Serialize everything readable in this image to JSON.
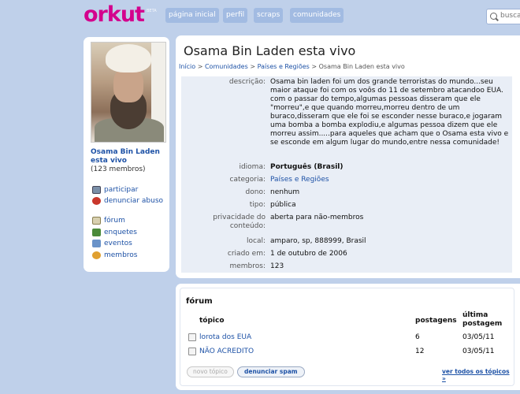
{
  "header": {
    "logo": "orkut",
    "logo_beta": "BETA",
    "nav": [
      "página inicial",
      "perfil",
      "scraps",
      "comunidades"
    ],
    "search_placeholder": "busca"
  },
  "sidebar": {
    "community_name": "Osama Bin Laden esta vivo",
    "members_count": "(123 membros)",
    "actions": [
      "participar",
      "denunciar abuso"
    ],
    "links": [
      "fórum",
      "enquetes",
      "eventos",
      "membros"
    ]
  },
  "main": {
    "title": "Osama Bin Laden esta vivo",
    "breadcrumb": [
      "Início",
      "Comunidades",
      "Países e Regiões",
      "Osama Bin Laden esta vivo"
    ],
    "breadcrumb_sep": ">",
    "fields": [
      {
        "label": "descrição:",
        "value": "Osama bin laden foi um dos grande terroristas do mundo...seu maior ataque foi com os voôs do 11 de setembro atacandoo EUA. com o passar do tempo,algumas pessoas disseram que ele \"morreu\",e que quando morreu,morreu dentro de um buraco,disseram que ele foi se esconder nesse buraco,e jogaram uma bomba a bomba explodiu,e algumas pessoa dizem que ele morreu assim.....para aqueles que acham que o Osama esta vivo e se esconde em algum lugar do mundo,entre nessa comunidade!"
      },
      {
        "label": "idioma:",
        "value": "Português (Brasil)"
      },
      {
        "label": "categoria:",
        "value": "Países e Regiões"
      },
      {
        "label": "dono:",
        "value": "nenhum"
      },
      {
        "label": "tipo:",
        "value": "pública"
      },
      {
        "label": "privacidade do conteúdo:",
        "value": "aberta para não-membros"
      },
      {
        "label": "local:",
        "value": "amparo, sp, 888999, Brasil"
      },
      {
        "label": "criado em:",
        "value": "1 de outubro de 2006"
      },
      {
        "label": "membros:",
        "value": "123"
      }
    ]
  },
  "forum": {
    "title": "fórum",
    "columns": {
      "topic": "tópico",
      "posts": "postagens",
      "last_post": "última postagem"
    },
    "topics": [
      {
        "title": "lorota dos EUA",
        "posts": "6",
        "last": "03/05/11"
      },
      {
        "title": "NÃO ACREDITO",
        "posts": "12",
        "last": "03/05/11"
      }
    ],
    "new_topic_label": "novo tópico",
    "report_spam_label": "denunciar spam",
    "see_all_label": "ver todos os tópicos »"
  },
  "colors": {
    "background": "#bfd0ea",
    "logo": "#d4008d",
    "link": "#1e52a6",
    "nav_button": "#a2bbe2",
    "info_box": "#e9eef6"
  },
  "icons": [
    "search-icon",
    "participate-icon",
    "report-abuse-icon",
    "forum-icon",
    "polls-icon",
    "events-icon",
    "members-icon"
  ]
}
